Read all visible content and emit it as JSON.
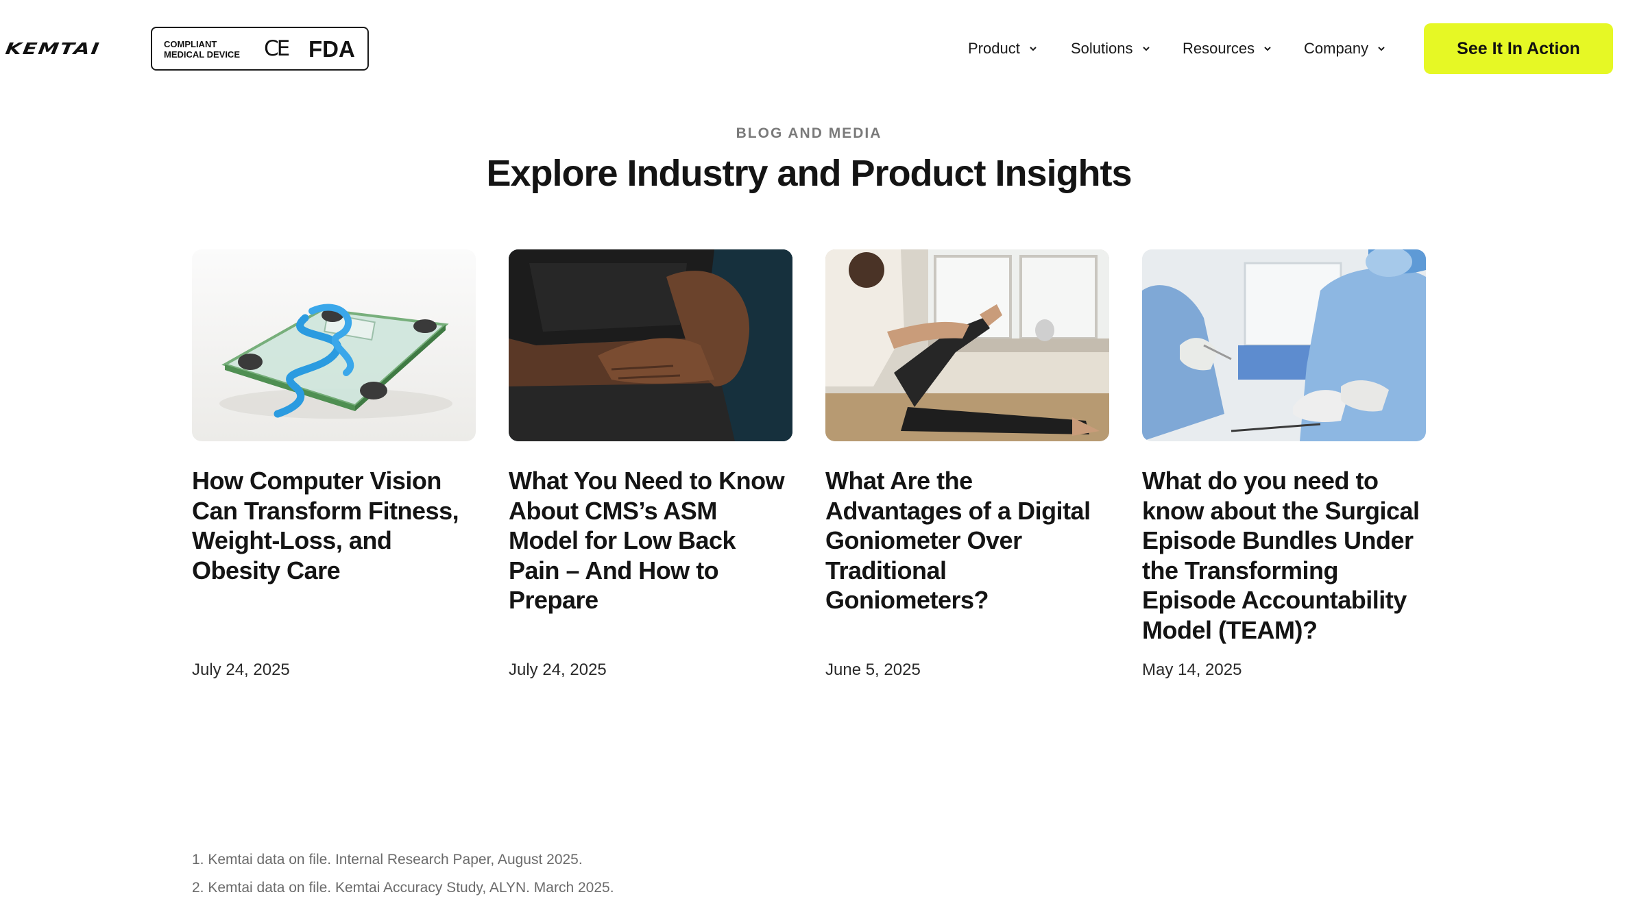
{
  "header": {
    "logo": "KEMTAI",
    "badge": {
      "line1": "COMPLIANT",
      "line2": "MEDICAL DEVICE",
      "ce": "CE",
      "fda": "FDA"
    },
    "nav": [
      {
        "label": "Product"
      },
      {
        "label": "Solutions"
      },
      {
        "label": "Resources"
      },
      {
        "label": "Company"
      }
    ],
    "cta": "See It In Action"
  },
  "section": {
    "eyebrow": "BLOG AND MEDIA",
    "title": "Explore Industry and Product Insights"
  },
  "articles": [
    {
      "title": "How Computer Vision Can Transform Fitness, Weight-Loss, and Obesity Care",
      "date": "July 24, 2025",
      "image": "glass-scale-with-measuring-tape"
    },
    {
      "title": "What You Need to Know About CMS’s ASM Model for Low Back Pain – And How to Prepare",
      "date": "July 24, 2025",
      "image": "person-holding-lower-back"
    },
    {
      "title": "What Are the Advantages of a Digital Goniometer Over Traditional Goniometers?",
      "date": "June 5, 2025",
      "image": "therapist-stretching-patient-leg"
    },
    {
      "title": "What do you need to know about the Surgical Episode Bundles Under the Transforming Episode Accountability Model (TEAM)?",
      "date": "May 14, 2025",
      "image": "surgeons-in-operating-room"
    }
  ],
  "footnotes": [
    "1. Kemtai data on file. Internal Research Paper, August 2025.",
    "2. Kemtai data on file. Kemtai Accuracy Study, ALYN. March 2025."
  ],
  "colors": {
    "cta_background": "#e6f825",
    "text": "#141414",
    "eyebrow": "#7a7a7a"
  }
}
